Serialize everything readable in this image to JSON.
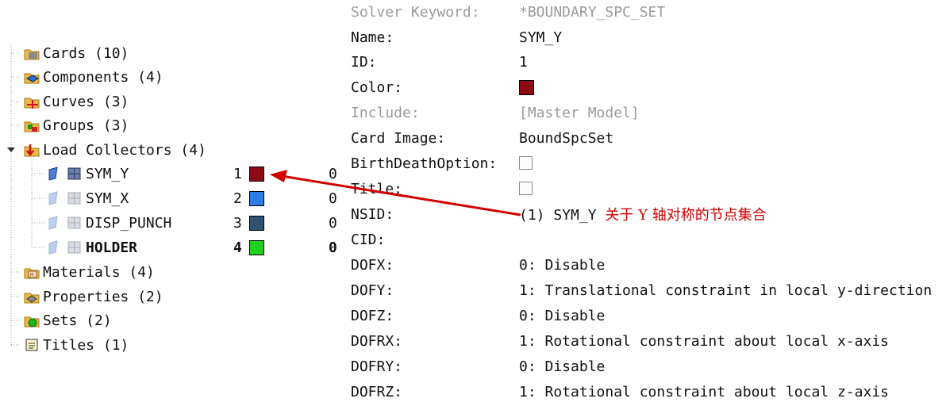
{
  "tree": {
    "top_items": [
      {
        "label": "Cards (10)",
        "icon": "cards-icon"
      },
      {
        "label": "Components (4)",
        "icon": "components-icon"
      },
      {
        "label": "Curves (3)",
        "icon": "curves-icon"
      },
      {
        "label": "Groups (3)",
        "icon": "groups-icon"
      },
      {
        "label": "Load Collectors (4)",
        "icon": "load-collectors-icon"
      }
    ],
    "load_collectors": [
      {
        "name": "SYM_Y",
        "id": "1",
        "color": "#8b0a14",
        "count": "0",
        "bold": false
      },
      {
        "name": "SYM_X",
        "id": "2",
        "color": "#2f7de8",
        "count": "0",
        "bold": false
      },
      {
        "name": "DISP_PUNCH",
        "id": "3",
        "color": "#2d5272",
        "count": "0",
        "bold": false
      },
      {
        "name": "HOLDER",
        "id": "4",
        "color": "#1fd21f",
        "count": "0",
        "bold": true
      }
    ],
    "bottom_items": [
      {
        "label": "Materials (4)",
        "icon": "materials-icon"
      },
      {
        "label": "Properties (2)",
        "icon": "properties-icon"
      },
      {
        "label": "Sets (2)",
        "icon": "sets-icon"
      },
      {
        "label": "Titles (1)",
        "icon": "titles-icon"
      }
    ]
  },
  "properties": {
    "solver_keyword": {
      "key": "Solver Keyword:",
      "value": "*BOUNDARY_SPC_SET"
    },
    "name": {
      "key": "Name:",
      "value": "SYM_Y"
    },
    "id": {
      "key": "ID:",
      "value": "1"
    },
    "color": {
      "key": "Color:",
      "value": "#8b0a14"
    },
    "include": {
      "key": "Include:",
      "value": "[Master Model]"
    },
    "card_image": {
      "key": "Card Image:",
      "value": "BoundSpcSet"
    },
    "birth_death": {
      "key": "BirthDeathOption:",
      "checked": false
    },
    "title": {
      "key": "Title:",
      "checked": false
    },
    "nsid": {
      "key": "NSID:",
      "value": "(1) SYM_Y",
      "annotation": "关于 Y 轴对称的节点集合"
    },
    "cid": {
      "key": "CID:",
      "value": ""
    },
    "dofx": {
      "key": "DOFX:",
      "value": "0: Disable"
    },
    "dofy": {
      "key": "DOFY:",
      "value": "1: Translational constraint in local y-direction"
    },
    "dofz": {
      "key": "DOFZ:",
      "value": "0: Disable"
    },
    "dofrx": {
      "key": "DOFRX:",
      "value": "1: Rotational constraint about local x-axis"
    },
    "dofry": {
      "key": "DOFRY:",
      "value": "0: Disable"
    },
    "dofrz": {
      "key": "DOFRZ:",
      "value": "1: Rotational constraint about local z-axis"
    }
  },
  "annotation_color": "#d00000"
}
